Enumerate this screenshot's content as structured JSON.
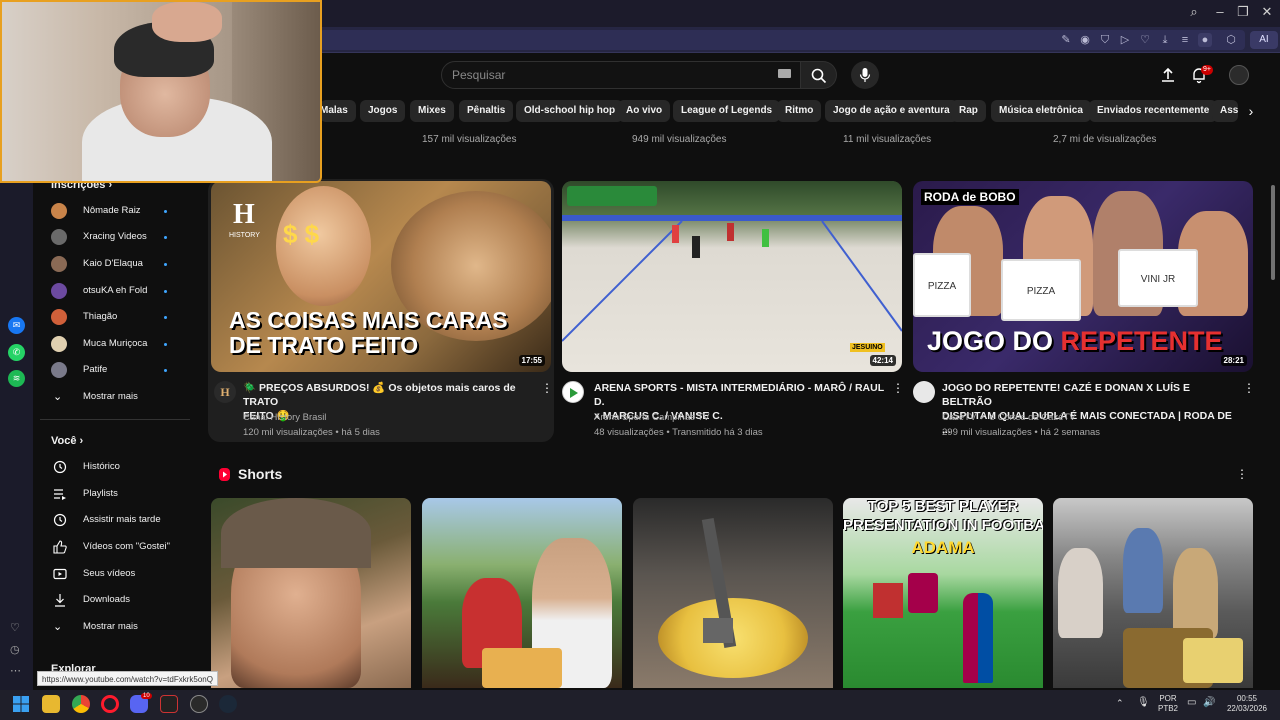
{
  "browser": {
    "ai_label": "AI",
    "window_controls": [
      "⌕",
      "–",
      "❐",
      "✕"
    ]
  },
  "header": {
    "search_placeholder": "Pesquisar",
    "notification_count": "9+"
  },
  "chips": [
    "Malas",
    "Jogos",
    "Mixes",
    "Pênaltis",
    "Old-school hip hop",
    "Ao vivo",
    "League of Legends",
    "Ritmo",
    "Jogo de ação e aventura",
    "Rap",
    "Música eletrônica",
    "Enviados recentemente",
    "Assi"
  ],
  "top_row_views": [
    "157 mil visualizações",
    "949 mil visualizações",
    "11 mil visualizações",
    "2,7 mi de visualizações"
  ],
  "sidebar": {
    "subscriptions_heading": "Inscrições",
    "subscriptions": [
      {
        "name": "Nômade Raiz",
        "color": "#c9844a"
      },
      {
        "name": "Xracing Videos",
        "color": "#6a6a6a"
      },
      {
        "name": "Kaio D'Elaqua",
        "color": "#8a6a55"
      },
      {
        "name": "otsuKA eh Fold",
        "color": "#6c4aa0"
      },
      {
        "name": "Thiagão",
        "color": "#d0603a"
      },
      {
        "name": "Muca Muriçoca",
        "color": "#e0d0b0"
      },
      {
        "name": "Patife",
        "color": "#7a7a8a"
      }
    ],
    "show_more_1": "Mostrar mais",
    "you_heading": "Você",
    "you_items": [
      "Histórico",
      "Playlists",
      "Assistir mais tarde",
      "Vídeos com \"Gostei\"",
      "Seus vídeos",
      "Downloads"
    ],
    "show_more_2": "Mostrar mais",
    "explore_heading": "Explorar"
  },
  "videos": [
    {
      "title_line1": "🪲 PREÇOS ABSURDOS! 💰 Os objetos mais caros de TRATO",
      "title_line2": "FEITO 🤑",
      "channel": "Canal History Brasil",
      "meta": "120 mil visualizações • há 5 dias",
      "duration": "17:55",
      "thumb_text_1": "AS COISAS MAIS CARAS",
      "thumb_text_2": "DE TRATO FEITO",
      "logo_letter": "H",
      "logo_word": "HISTORY"
    },
    {
      "title_line1": "ARENA SPORTS - MISTA INTERMEDIÁRIO - MARÔ / RAUL D.",
      "title_line2": "x MARCUS C. / VANISE C.",
      "channel": "Arena Sports Campinas TV",
      "meta": "48 visualizações • Transmitido há 3 dias",
      "duration": "42:14",
      "badge": "JESUINO"
    },
    {
      "title_line1": "JOGO DO REPETENTE! CAZÉ E DONAN X LUÍS E BELTRÃO",
      "title_line2": "DISPUTAM QUAL DUPLA É MAIS CONECTADA | RODA DE ...",
      "channel": "CazéTV ✔ e Cortes da CazéTV",
      "meta": "299 mil visualizações • há 2 semanas",
      "duration": "28:21",
      "thumb_tag": "RODA de BOBO",
      "thumb_text_white": "JOGO DO ",
      "thumb_text_red": "REPETENTE",
      "board_1": "PIZZA",
      "board_2": "PIZZA",
      "board_3": "VINI JR"
    }
  ],
  "shorts": {
    "heading": "Shorts",
    "items": [
      {
        "overlay_1": "",
        "overlay_2": "",
        "overlay_3": ""
      },
      {
        "overlay_1": "",
        "overlay_2": "",
        "overlay_3": ""
      },
      {
        "overlay_1": "",
        "overlay_2": "",
        "overlay_3": ""
      },
      {
        "overlay_1": "TOP 5 BEST PLAYER",
        "overlay_2": "PRESENTATION IN FOOTBALL",
        "overlay_3": "ADAMA"
      },
      {
        "overlay_1": "",
        "overlay_2": "",
        "overlay_3": ""
      }
    ]
  },
  "status_url": "https://www.youtube.com/watch?v=tdFxkrk5onQ",
  "taskbar": {
    "lang_1": "POR",
    "lang_2": "PTB2",
    "time": "00:55",
    "date": "22/03/2026",
    "discord_badge": "10"
  }
}
